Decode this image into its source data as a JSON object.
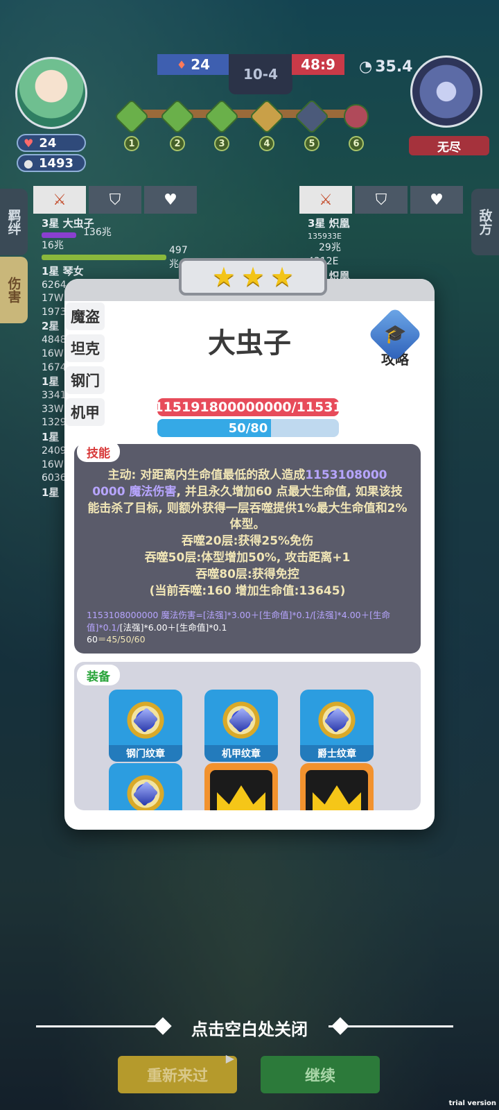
{
  "hud": {
    "blue_score": "24",
    "round": "10-4",
    "red_score": "48:9",
    "timer": "35.4",
    "player_hp": "24",
    "player_gold": "1493",
    "enemy_name": "无尽",
    "stages": [
      "1",
      "2",
      "3",
      "4",
      "5",
      "6"
    ]
  },
  "side_tabs": {
    "bond": "羁绊",
    "damage": "伤害",
    "enemy": "敌方"
  },
  "left_panel": {
    "rows": [
      {
        "title": "3星 大虫子",
        "v1": "136兆",
        "v2": "16兆",
        "v3": "497兆"
      },
      {
        "title": "1星 琴女",
        "v1": "6264",
        "v2": "17W",
        "v3": "1973"
      },
      {
        "title": "2星",
        "v1": "4848",
        "v2": "16W",
        "v3": "1674"
      },
      {
        "title": "1星",
        "v1": "3341",
        "v2": "33W",
        "v3": "1329"
      },
      {
        "title": "1星",
        "v1": "2409",
        "v2": "16W",
        "v3": "6036"
      },
      {
        "title": "1星",
        "v1": "",
        "v2": "",
        "v3": ""
      }
    ]
  },
  "right_panel": {
    "rows": [
      {
        "title": "3星 炽凰",
        "v1": "135933E",
        "v2": "29兆",
        "v3": "4312E"
      },
      {
        "title": "3星 炽凰",
        "v1": "",
        "v2": "",
        "v3": ""
      }
    ]
  },
  "modal": {
    "stars": 3,
    "classes": [
      "魔盗",
      "坦克",
      "钢门",
      "机甲"
    ],
    "unit_name": "大虫子",
    "strategy_label": "攻略",
    "hp_text": "115191800000000/11531",
    "mana_text": "50/80",
    "mana_fraction": 0.625,
    "skill_tag": "技能",
    "skill_lines": [
      "主动: 对距离内生命值最低的敌人造成",
      "1153108000",
      "0000 魔法伤害",
      ", 并且永久增加60 点最大生命值, 如果该技能击杀了目标, 则额外获得一层吞噬提供1%最大生命值和2%体型。",
      "吞噬20层:获得25%免伤",
      "吞噬50层:体型增加50%, 攻击距离+1",
      "吞噬80层:获得免控",
      "(当前吞噬:160 增加生命值:13645)"
    ],
    "formula_1": "1153108000000 魔法伤害=[法强]*3.00＋[生命值]*0.1/[法强]*4.00＋[生命值]*0.1/",
    "formula_2": "[法强]*6.00＋[生命值]*0.1",
    "formula_3": "60",
    "formula_4": "＝45/50/60",
    "equip_tag": "装备",
    "equipment": [
      {
        "label": "钢门纹章",
        "type": "emblem"
      },
      {
        "label": "机甲纹章",
        "type": "emblem"
      },
      {
        "label": "爵士纹章",
        "type": "emblem"
      },
      {
        "label": "",
        "type": "emblem"
      },
      {
        "label": "",
        "type": "crown"
      },
      {
        "label": "",
        "type": "crown"
      }
    ]
  },
  "bottom": {
    "close_hint": "点击空白处关闭",
    "again_label": "重新来过",
    "continue_label": "继续",
    "watermark": "trial version"
  }
}
